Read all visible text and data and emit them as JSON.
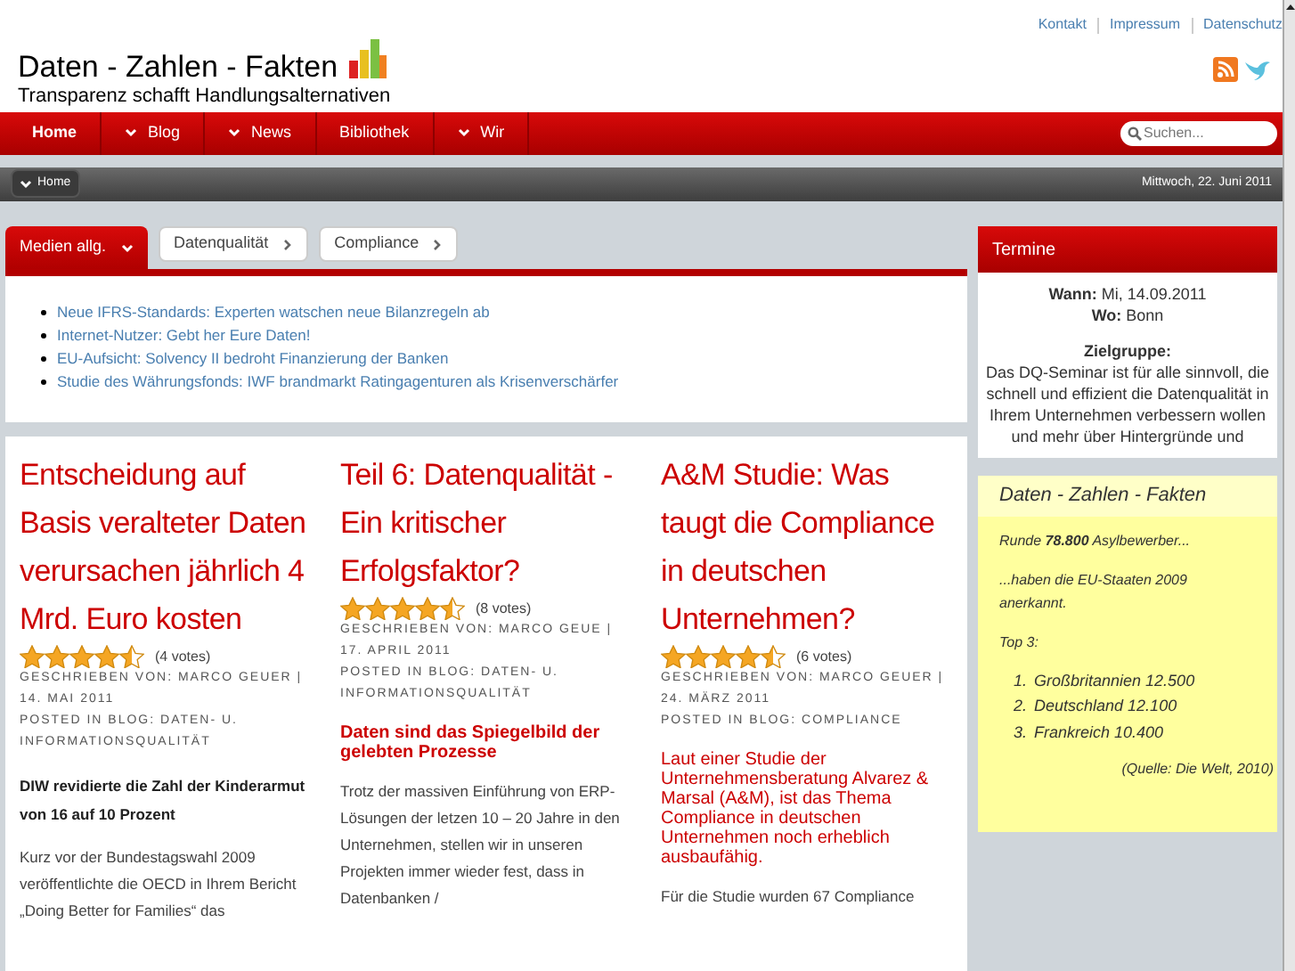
{
  "top_links": [
    "Kontakt",
    "Impressum",
    "Datenschutz"
  ],
  "site": {
    "title": "Daten - Zahlen - Fakten",
    "tagline": "Transparenz schafft Handlungsalternativen"
  },
  "nav": [
    {
      "label": "Home",
      "dropdown": false,
      "selected": true
    },
    {
      "label": "Blog",
      "dropdown": true,
      "selected": false
    },
    {
      "label": "News",
      "dropdown": true,
      "selected": false
    },
    {
      "label": "Bibliothek",
      "dropdown": false,
      "selected": false
    },
    {
      "label": "Wir",
      "dropdown": true,
      "selected": false
    }
  ],
  "search": {
    "placeholder": "Suchen..."
  },
  "breadcrumb": {
    "label": "Home",
    "date": "Mittwoch, 22. Juni 2011"
  },
  "tabs": [
    {
      "label": "Medien allg.",
      "selected": true
    },
    {
      "label": "Datenqualität",
      "selected": false
    },
    {
      "label": "Compliance",
      "selected": false
    }
  ],
  "news": [
    "Neue IFRS-Standards: Experten watschen neue Bilanzregeln ab",
    "Internet-Nutzer: Gebt her Eure Daten!",
    "EU-Aufsicht: Solvency II bedroht Finanzierung der Banken",
    "Studie des Währungsfonds: IWF brandmarkt Ratingagenturen als Krisenverschärfer"
  ],
  "articles": [
    {
      "title": "Entscheidung auf Basis veralteter Daten verursachen jährlich 4 Mrd. Euro kosten",
      "stars": 4.5,
      "votes": "(4 votes)",
      "byline": "GESCHRIEBEN VON: MARCO GEUER | 14. MAI 2011",
      "posted": "POSTED IN BLOG: DATEN- U. INFORMATIONSQUALITÄT",
      "lead": {
        "kind": "bold",
        "text": "DIW revidierte die Zahl der Kinderarmut von 16 auf 10 Prozent"
      },
      "body": "Kurz vor der Bundestagswahl 2009 veröffentlichte die OECD in Ihrem Bericht „Doing Better for Families“ das"
    },
    {
      "title": "Teil 6: Datenqualität - Ein kritischer Erfolgsfaktor?",
      "stars": 4.5,
      "votes": "(8 votes)",
      "byline": "GESCHRIEBEN VON: MARCO GEUE | 17. APRIL 2011",
      "posted": "POSTED IN BLOG: DATEN- U. INFORMATIONSQUALITÄT",
      "lead": {
        "kind": "heading",
        "text": "Daten sind das Spiegelbild der gelebten Prozesse"
      },
      "body": "Trotz der massiven Einführung von ERP-Lösungen der letzen 10 – 20 Jahre in den Unternehmen, stellen wir in unseren Projekten immer wieder fest, dass in Datenbanken /"
    },
    {
      "title": "A&M Studie: Was taugt die Compliance in deutschen Unternehmen?",
      "stars": 4.5,
      "votes": "(6 votes)",
      "byline": "GESCHRIEBEN VON: MARCO GEUER | 24. MÄRZ 2011",
      "posted": "POSTED IN BLOG: COMPLIANCE",
      "lead": {
        "kind": "red",
        "text": "Laut einer Studie der Unternehmensberatung Alvarez & Marsal (A&M), ist das Thema Compliance in deutschen Unternehmen noch erheblich ausbaufähig."
      },
      "body": "Für die Studie wurden 67 Compliance"
    }
  ],
  "termine": {
    "title": "Termine",
    "lines": [
      "**Wann:** Mi, 14.09.2011",
      "**Wo:** Bonn"
    ],
    "heading": "Zielgruppe:",
    "text": "Das DQ-Seminar ist für alle sinnvoll, die schnell und effizient die Datenqualität in Ihrem Unternehmen verbessern wollen und mehr über Hintergründe und"
  },
  "facts": {
    "title": "Daten - Zahlen - Fakten",
    "paragraphs": [
      "Runde **78.800** Asylbewerber...",
      "...haben die EU-Staaten 2009 anerkannt.",
      "Top 3:"
    ],
    "list": [
      {
        "number": "1.",
        "text": "Großbritannien 12.500"
      },
      {
        "number": "2.",
        "text": "Deutschland 12.100"
      },
      {
        "number": "3.",
        "text": "Frankreich 10.400"
      }
    ],
    "source": "(Quelle: Die Welt, 2010)"
  }
}
